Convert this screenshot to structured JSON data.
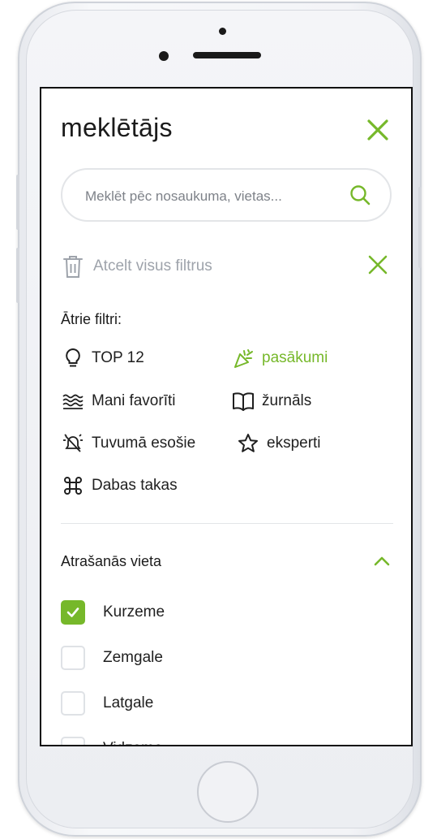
{
  "colors": {
    "accent": "#76b82a",
    "text": "#1f1f1f",
    "muted": "#9ea3ab",
    "border": "#e3e5e8"
  },
  "header": {
    "title": "meklētājs",
    "close_icon": "close-icon"
  },
  "search": {
    "placeholder": "Meklēt pēc nosaukuma, vietas...",
    "value": "",
    "icon": "search-icon"
  },
  "clear_filters": {
    "label": "Atcelt visus filtrus",
    "icon": "trash-icon",
    "clear_icon": "close-icon"
  },
  "quick_filters": {
    "title": "Ātrie filtri:",
    "items": [
      {
        "label": "TOP 12",
        "icon": "lightbulb-icon",
        "active": false
      },
      {
        "label": "pasākumi",
        "icon": "party-popper-icon",
        "active": true
      },
      {
        "label": "Mani favorīti",
        "icon": "waves-icon",
        "active": false
      },
      {
        "label": "žurnāls",
        "icon": "open-book-icon",
        "active": false
      },
      {
        "label": "Tuvumā esošie",
        "icon": "alarm-bell-icon",
        "active": false
      },
      {
        "label": "eksperti",
        "icon": "star-icon",
        "active": false
      },
      {
        "label": "Dabas takas",
        "icon": "command-key-icon",
        "active": false
      }
    ]
  },
  "location": {
    "title": "Atrašanās vieta",
    "expanded": true,
    "options": [
      {
        "label": "Kurzeme",
        "checked": true
      },
      {
        "label": "Zemgale",
        "checked": false
      },
      {
        "label": "Latgale",
        "checked": false
      },
      {
        "label": "Vidzeme",
        "checked": false
      }
    ]
  }
}
